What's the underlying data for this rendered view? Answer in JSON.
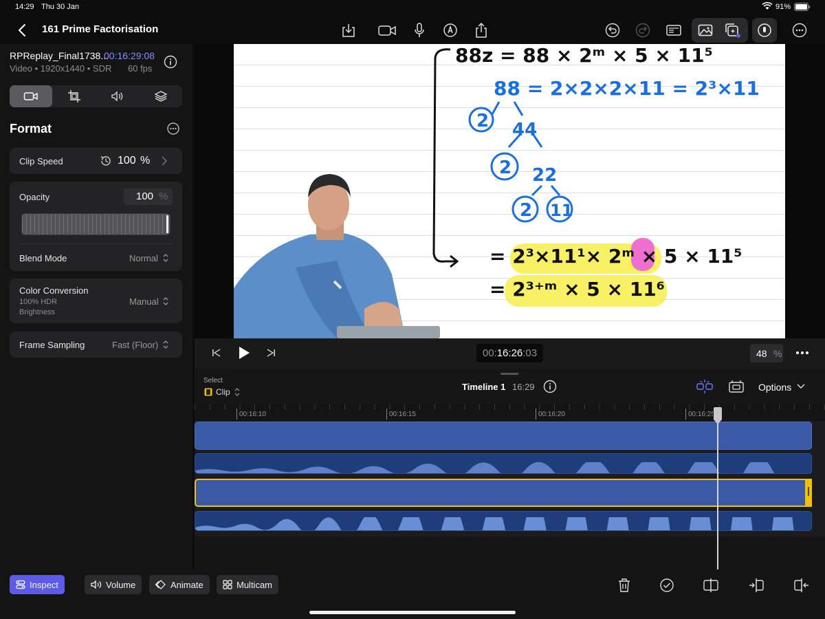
{
  "status": {
    "time": "14:29",
    "date": "Thu 30 Jan",
    "battery": "91%"
  },
  "project": {
    "title": "161 Prime Factorisation"
  },
  "clip_info": {
    "name": "RPReplay_Final1738...",
    "timecode": "00:16:29:08",
    "format": "Video • 1920x1440 • SDR",
    "fps": "60 fps"
  },
  "inspector": {
    "section_title": "Format",
    "clip_speed": {
      "label": "Clip Speed",
      "value": "100",
      "unit": "%"
    },
    "opacity": {
      "label": "Opacity",
      "value": "100",
      "unit": "%",
      "level": 1.0
    },
    "blend_mode": {
      "label": "Blend Mode",
      "value": "Normal"
    },
    "color_conversion": {
      "label": "Color Conversion",
      "sub1": "100% HDR",
      "sub2": "Brightness",
      "value": "Manual"
    },
    "frame_sampling": {
      "label": "Frame Sampling",
      "value": "Fast (Floor)"
    }
  },
  "viewer": {
    "board": {
      "line1": "88z = 88 × 2ᵐ × 5 × 11⁵",
      "line2": "88 = 2×2×2×11 = 2³×11",
      "tree_44": "44",
      "tree_22": "22",
      "leaf_2": "2",
      "leaf_11": "11",
      "line3": "= 2³×11¹× 2ᵐ × 5 × 11⁵",
      "line4": "= 2³⁺ᵐ × 5 × 11⁶"
    }
  },
  "transport": {
    "timecode_dim": "00:",
    "timecode": "16:26",
    "frames": ":03",
    "zoom": "48",
    "zoom_unit": "%"
  },
  "timeline": {
    "select_label": "Select",
    "select_value": "Clip",
    "name": "Timeline 1",
    "duration": "16:29",
    "options": "Options",
    "playhead_fraction": 0.83
  },
  "ruler": {
    "ticks": [
      "00:16:10",
      "00:16:15",
      "00:16:20",
      "00:16:25"
    ]
  },
  "bottom_bar": {
    "inspect": "Inspect",
    "volume": "Volume",
    "animate": "Animate",
    "multicam": "Multicam"
  },
  "colors": {
    "accent": "#5e5ce6",
    "clip_blue": "#3a5aa8",
    "audio_blue": "#1f3d7a",
    "selection_yellow": "#f2c200",
    "timecode_purple": "#8a8cff"
  }
}
